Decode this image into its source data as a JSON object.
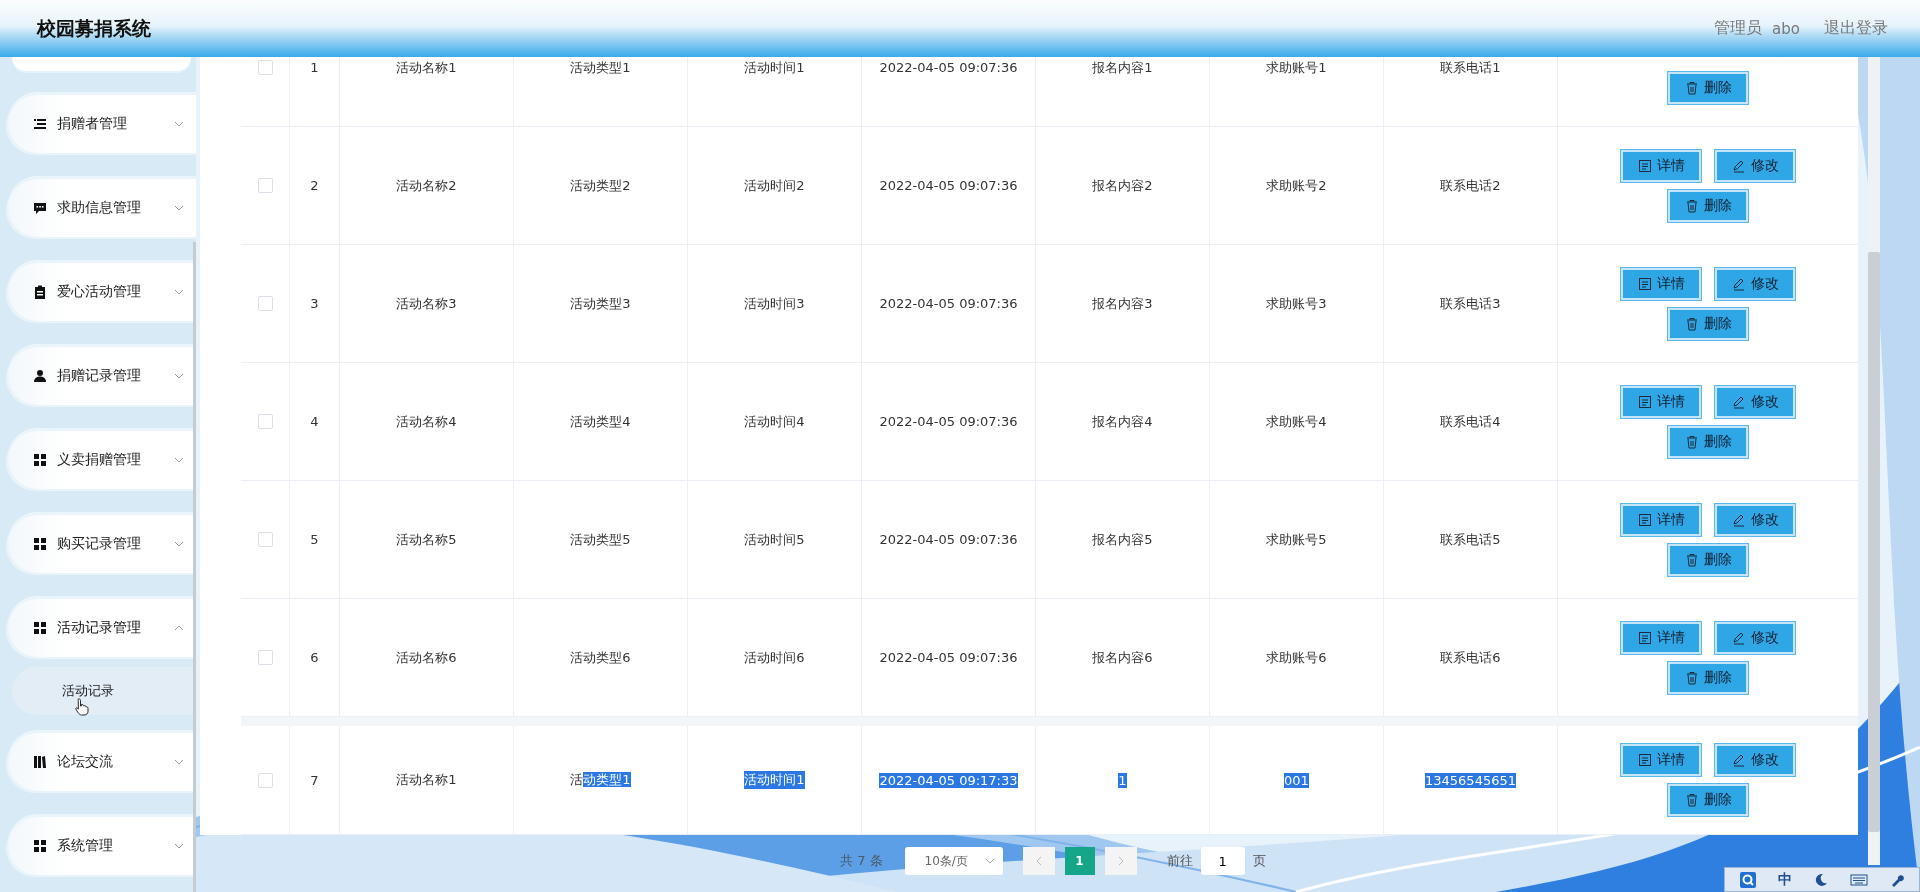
{
  "header": {
    "title": "校园募捐系统",
    "user_role": "管理员",
    "user_name": "abo",
    "logout": "退出登录"
  },
  "sidebar": {
    "items": [
      {
        "label": "捐赠者管理",
        "expanded": false
      },
      {
        "label": "求助信息管理",
        "expanded": false
      },
      {
        "label": "爱心活动管理",
        "expanded": false
      },
      {
        "label": "捐赠记录管理",
        "expanded": false
      },
      {
        "label": "义卖捐赠管理",
        "expanded": false
      },
      {
        "label": "购买记录管理",
        "expanded": false
      },
      {
        "label": "活动记录管理",
        "expanded": true,
        "children": [
          {
            "label": "活动记录",
            "hovered": true
          }
        ]
      },
      {
        "label": "论坛交流",
        "expanded": false
      },
      {
        "label": "系统管理",
        "expanded": false
      }
    ]
  },
  "table": {
    "rows": [
      {
        "checked": false,
        "index": "1",
        "cells": [
          {
            "text": "活动名称1"
          },
          {
            "text": "活动类型1"
          },
          {
            "text": "活动时间1"
          },
          {
            "text": "2022-04-05 09:07:36"
          },
          {
            "text": "报名内容1"
          },
          {
            "text": "求助账号1"
          },
          {
            "text": "联系电话1"
          }
        ],
        "actions": [
          {
            "label": "删除",
            "kind": "delete"
          }
        ]
      },
      {
        "checked": false,
        "index": "2",
        "cells": [
          {
            "text": "活动名称2"
          },
          {
            "text": "活动类型2"
          },
          {
            "text": "活动时间2"
          },
          {
            "text": "2022-04-05 09:07:36"
          },
          {
            "text": "报名内容2"
          },
          {
            "text": "求助账号2"
          },
          {
            "text": "联系电话2"
          }
        ],
        "actions": [
          {
            "label": "详情",
            "kind": "detail"
          },
          {
            "label": "修改",
            "kind": "edit"
          },
          {
            "label": "删除",
            "kind": "delete"
          }
        ]
      },
      {
        "checked": false,
        "index": "3",
        "cells": [
          {
            "text": "活动名称3"
          },
          {
            "text": "活动类型3"
          },
          {
            "text": "活动时间3"
          },
          {
            "text": "2022-04-05 09:07:36"
          },
          {
            "text": "报名内容3"
          },
          {
            "text": "求助账号3"
          },
          {
            "text": "联系电话3"
          }
        ],
        "actions": [
          {
            "label": "详情",
            "kind": "detail"
          },
          {
            "label": "修改",
            "kind": "edit"
          },
          {
            "label": "删除",
            "kind": "delete"
          }
        ]
      },
      {
        "checked": false,
        "index": "4",
        "cells": [
          {
            "text": "活动名称4"
          },
          {
            "text": "活动类型4"
          },
          {
            "text": "活动时间4"
          },
          {
            "text": "2022-04-05 09:07:36"
          },
          {
            "text": "报名内容4"
          },
          {
            "text": "求助账号4"
          },
          {
            "text": "联系电话4"
          }
        ],
        "actions": [
          {
            "label": "详情",
            "kind": "detail"
          },
          {
            "label": "修改",
            "kind": "edit"
          },
          {
            "label": "删除",
            "kind": "delete"
          }
        ]
      },
      {
        "checked": false,
        "index": "5",
        "cells": [
          {
            "text": "活动名称5"
          },
          {
            "text": "活动类型5"
          },
          {
            "text": "活动时间5"
          },
          {
            "text": "2022-04-05 09:07:36"
          },
          {
            "text": "报名内容5"
          },
          {
            "text": "求助账号5"
          },
          {
            "text": "联系电话5"
          }
        ],
        "actions": [
          {
            "label": "详情",
            "kind": "detail"
          },
          {
            "label": "修改",
            "kind": "edit"
          },
          {
            "label": "删除",
            "kind": "delete"
          }
        ]
      },
      {
        "checked": false,
        "index": "6",
        "cells": [
          {
            "text": "活动名称6"
          },
          {
            "text": "活动类型6"
          },
          {
            "text": "活动时间6"
          },
          {
            "text": "2022-04-05 09:07:36"
          },
          {
            "text": "报名内容6"
          },
          {
            "text": "求助账号6"
          },
          {
            "text": "联系电话6"
          }
        ],
        "actions": [
          {
            "label": "详情",
            "kind": "detail"
          },
          {
            "label": "修改",
            "kind": "edit"
          },
          {
            "label": "删除",
            "kind": "delete"
          }
        ]
      },
      {
        "checked": false,
        "index": "7",
        "cells": [
          {
            "text": "活动名称1",
            "highlighted": false
          },
          {
            "parts": [
              {
                "text": "活",
                "highlighted": false
              },
              {
                "text": "动类型1",
                "highlighted": true
              }
            ]
          },
          {
            "text": "活动时间1",
            "highlighted": true
          },
          {
            "text": "2022-04-05 09:17:33",
            "highlighted": true
          },
          {
            "text": "1",
            "highlighted": true
          },
          {
            "text": "001",
            "highlighted": true
          },
          {
            "text": "13456545651",
            "highlighted": true
          }
        ],
        "actions": [
          {
            "label": "详情",
            "kind": "detail"
          },
          {
            "label": "修改",
            "kind": "edit"
          },
          {
            "label": "删除",
            "kind": "delete"
          }
        ]
      }
    ]
  },
  "pagination": {
    "total": "共 7 条",
    "page_size": "10条/页",
    "pages": [
      {
        "label": "1",
        "selected": true
      }
    ],
    "goto_label": "前往",
    "goto_value": "1",
    "goto_suffix": "页"
  },
  "ime": {
    "mode": "中"
  }
}
